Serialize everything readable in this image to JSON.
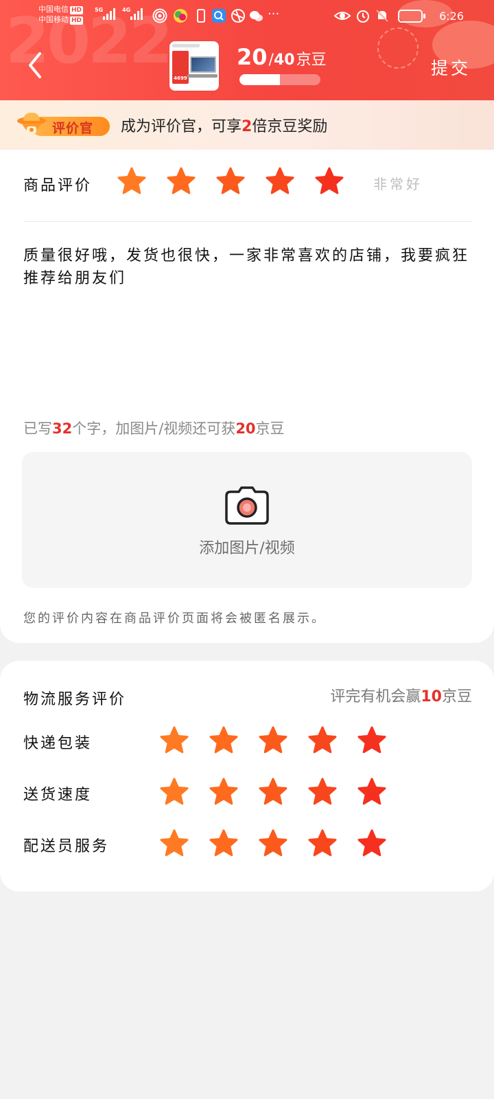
{
  "status_bar": {
    "carrier1": "中国电信",
    "carrier2": "中国移动",
    "hd": "HD",
    "net1": "5G",
    "net2": "4G",
    "time": "6:26"
  },
  "header": {
    "points_current": "20",
    "points_separator": "/",
    "points_total": "40",
    "points_unit": "京豆",
    "progress_fraction": 0.5,
    "submit_label": "提交",
    "product_price_tag": "4699",
    "deco_text": "2022"
  },
  "banner": {
    "badge_label": "评价官",
    "text_before": "成为评价官，可享",
    "multiplier": "2",
    "text_after": "倍京豆奖励"
  },
  "product_rating": {
    "label": "商品评价",
    "stars": 5,
    "max_stars": 5,
    "rating_text": "非常好"
  },
  "review": {
    "text": "质量很好哦，发货也很快，一家非常喜欢的店铺，我要疯狂推荐给朋友们",
    "count_prefix": "已写",
    "count": "32",
    "count_mid": "个字，加图片/视频还可获",
    "bonus": "20",
    "bonus_unit": "京豆",
    "upload_label": "添加图片/视频",
    "anonymous_note": "您的评价内容在商品评价页面将会被匿名展示。"
  },
  "logistics": {
    "title": "物流服务评价",
    "hint_prefix": "评完有机会赢",
    "hint_amount": "10",
    "hint_unit": "京豆",
    "items": [
      {
        "label": "快递包装",
        "stars": 5
      },
      {
        "label": "送货速度",
        "stars": 5
      },
      {
        "label": "配送员服务",
        "stars": 5
      }
    ]
  },
  "colors": {
    "header_red": "#f5463f",
    "accent_red": "#e4312b",
    "star_from": "#ff7a22",
    "star_to": "#f5301e"
  }
}
